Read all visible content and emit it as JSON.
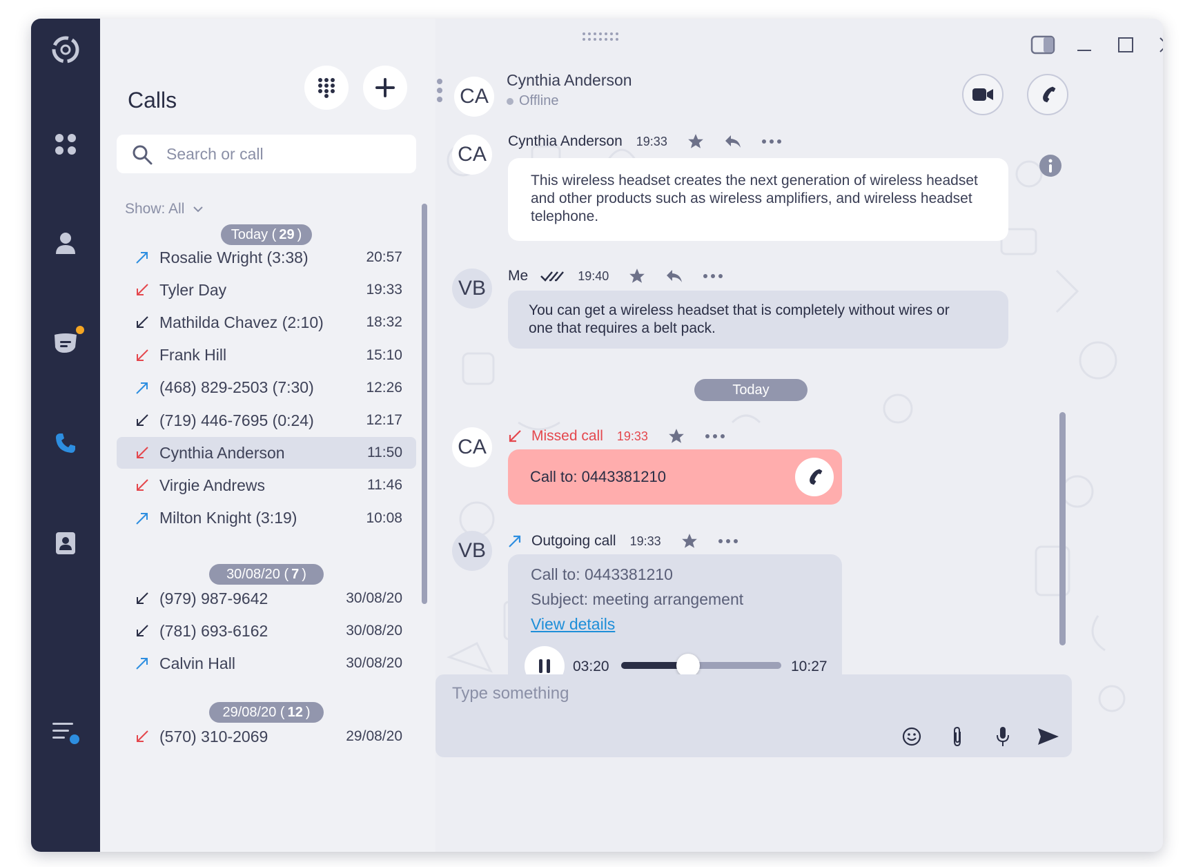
{
  "nav": {
    "items": [
      {
        "name": "app-logo-icon"
      },
      {
        "name": "apps-grid-icon"
      },
      {
        "name": "profile-icon"
      },
      {
        "name": "chat-icon"
      },
      {
        "name": "phone-icon"
      },
      {
        "name": "contacts-icon"
      },
      {
        "name": "menu-icon"
      }
    ],
    "notification_color": "#f5a623",
    "active_color": "#2d8ee0"
  },
  "calls_panel": {
    "title": "Calls",
    "search_placeholder": "Search or call",
    "filter": "Show: All",
    "groups": [
      {
        "label": "Today",
        "count": "29",
        "rows": [
          {
            "direction": "outgoing",
            "name": "Rosalie Wright (3:38)",
            "time": "20:57"
          },
          {
            "direction": "missed",
            "name": "Tyler Day",
            "time": "19:33"
          },
          {
            "direction": "incoming",
            "name": "Mathilda Chavez (2:10)",
            "time": "18:32"
          },
          {
            "direction": "missed",
            "name": "Frank Hill",
            "time": "15:10"
          },
          {
            "direction": "outgoing",
            "name": "(468) 829-2503 (7:30)",
            "time": "12:26"
          },
          {
            "direction": "incoming",
            "name": "(719) 446-7695 (0:24)",
            "time": "12:17"
          },
          {
            "direction": "missed",
            "name": "Cynthia Anderson",
            "time": "11:50",
            "selected": true
          },
          {
            "direction": "missed",
            "name": "Virgie Andrews",
            "time": "11:46"
          },
          {
            "direction": "outgoing",
            "name": "Milton Knight (3:19)",
            "time": "10:08"
          }
        ]
      },
      {
        "label": "30/08/20",
        "count": "7",
        "rows": [
          {
            "direction": "incoming",
            "name": "(979) 987-9642",
            "time": "30/08/20"
          },
          {
            "direction": "incoming",
            "name": "(781) 693-6162",
            "time": "30/08/20"
          },
          {
            "direction": "outgoing",
            "name": "Calvin Hall",
            "time": "30/08/20"
          }
        ]
      },
      {
        "label": "29/08/20",
        "count": "12",
        "rows": [
          {
            "direction": "missed",
            "name": "(570) 310-2069",
            "time": "29/08/20"
          }
        ]
      }
    ]
  },
  "chat": {
    "contact": {
      "initials": "CA",
      "name": "Cynthia Anderson",
      "status": "Offline"
    },
    "messages": [
      {
        "initials": "CA",
        "author": "Cynthia Anderson",
        "time": "19:33",
        "text": "This wireless headset creates the next generation of wireless headset and other products such as wireless amplifiers, and wireless headset telephone."
      },
      {
        "initials": "VB",
        "author": "Me",
        "time": "19:40",
        "text": "You can get a wireless headset that is completely without wires or one that requires a belt pack."
      }
    ],
    "separator": "Today",
    "missed_call": {
      "initials": "CA",
      "label": "Missed call",
      "time": "19:33",
      "body": "Call to: 0443381210"
    },
    "outgoing_call": {
      "initials": "VB",
      "label": "Outgoing call",
      "time": "19:33",
      "call_to": "Call to: 0443381210",
      "subject": "Subject: meeting arrangement",
      "details_link": "View details",
      "elapsed": "03:20",
      "duration": "10:27",
      "progress": 0.42
    },
    "composer_placeholder": "Type something"
  },
  "colors": {
    "missed": "#e4474d",
    "outgoing": "#2d8ee0",
    "missed_bubble": "#ffadad",
    "accent_link": "#1e8ed8"
  }
}
